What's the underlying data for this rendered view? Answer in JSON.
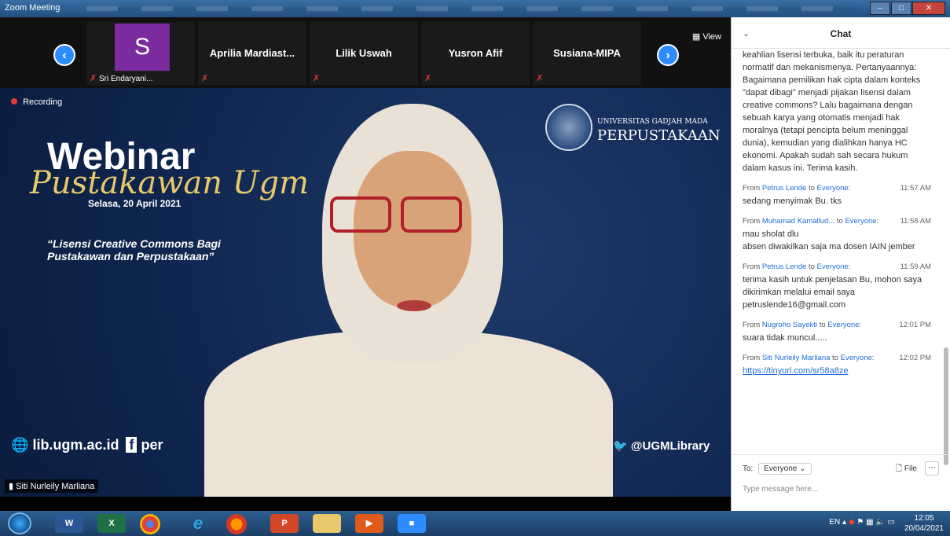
{
  "window": {
    "title": "Zoom Meeting",
    "min": "–",
    "max": "□",
    "close": "✕"
  },
  "strip": {
    "view_label": "View",
    "participants": [
      {
        "name": "S",
        "caption": "Sri Endaryani..."
      },
      {
        "name": "Aprilia  Mardiast..."
      },
      {
        "name": "Lilik Uswah"
      },
      {
        "name": "Yusron Afif"
      },
      {
        "name": "Susiana-MIPA"
      }
    ]
  },
  "video": {
    "recording": "Recording",
    "webinar": "Webinar",
    "script": "Pustakawan Ugm",
    "date": "Selasa, 20 April 2021",
    "quote": "“Lisensi Creative Commons Bagi Pustakawan dan Perpustakaan”",
    "university": "UNIVERSITAS GADJAH MADA",
    "library": "PERPUSTAKAAN",
    "website": "lib.ugm.ac.id",
    "facebook": "per",
    "twitter": "@UGMLibrary",
    "speaker": "Siti Nurleily Marliana"
  },
  "chat": {
    "title": "Chat",
    "continued_text": "keahlian lisensi terbuka, baik itu peraturan normatif dan mekanismenya. Pertanyaannya: Bagaimana pemilikan hak cipta dalam konteks \"dapat dibagi\" menjadi pijakan lisensi dalam creative commons? Lalu bagaimana dengan sebuah karya yang otomatis menjadi hak moralnya (tetapi pencipta belum meninggal dunia), kemudian yang dialihkan hanya HC ekonomi. Apakah sudah sah secara hukum dalam kasus ini. Terima kasih.",
    "messages": [
      {
        "from": "Petrus Lende",
        "to": "Everyone",
        "time": "11:57 AM",
        "text": "sedang menyimak Bu. tks"
      },
      {
        "from": "Muhamad Kamallud...",
        "to": "Everyone",
        "time": "11:58 AM",
        "text": "mau sholat dlu\nabsen diwakilkan saja ma dosen IAIN jember"
      },
      {
        "from": "Petrus Lende",
        "to": "Everyone",
        "time": "11:59 AM",
        "text": "terima kasih untuk penjelasan Bu, mohon saya dikirimkan melalui email saya petruslende16@gmail.com"
      },
      {
        "from": "Nugroho Sayekti",
        "to": "Everyone",
        "time": "12:01 PM",
        "text": "suara tidak muncul....."
      },
      {
        "from": "Siti Nurleily Marliana",
        "to": "Everyone",
        "time": "12:02 PM",
        "text": "https://tinyurl.com/sr58a8ze"
      }
    ],
    "from_label": "From",
    "to_word": "to",
    "to_label": "To:",
    "to_value": "Everyone",
    "file_label": "File",
    "more_label": "···",
    "placeholder": "Type message here..."
  },
  "taskbar": {
    "apps": [
      "W",
      "X",
      "",
      "e",
      "",
      "P",
      "",
      "▶",
      "■"
    ],
    "lang": "EN",
    "time": "12:05",
    "date": "20/04/2021"
  }
}
